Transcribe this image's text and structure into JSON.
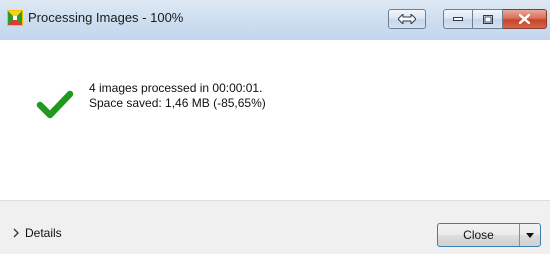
{
  "window": {
    "title": "Processing Images - 100%"
  },
  "message": {
    "line1": "4 images processed in 00:00:01.",
    "line2": "Space saved: 1,46 MB (-85,65%)"
  },
  "footer": {
    "details_label": "Details",
    "close_label": "Close"
  },
  "icons": {
    "app": "image-processor-icon",
    "status": "checkmark-icon",
    "details": "chevron-right-icon",
    "dropdown": "dropdown-arrow-icon"
  },
  "colors": {
    "success": "#1f9a1f",
    "close_button": "#c7442a"
  }
}
